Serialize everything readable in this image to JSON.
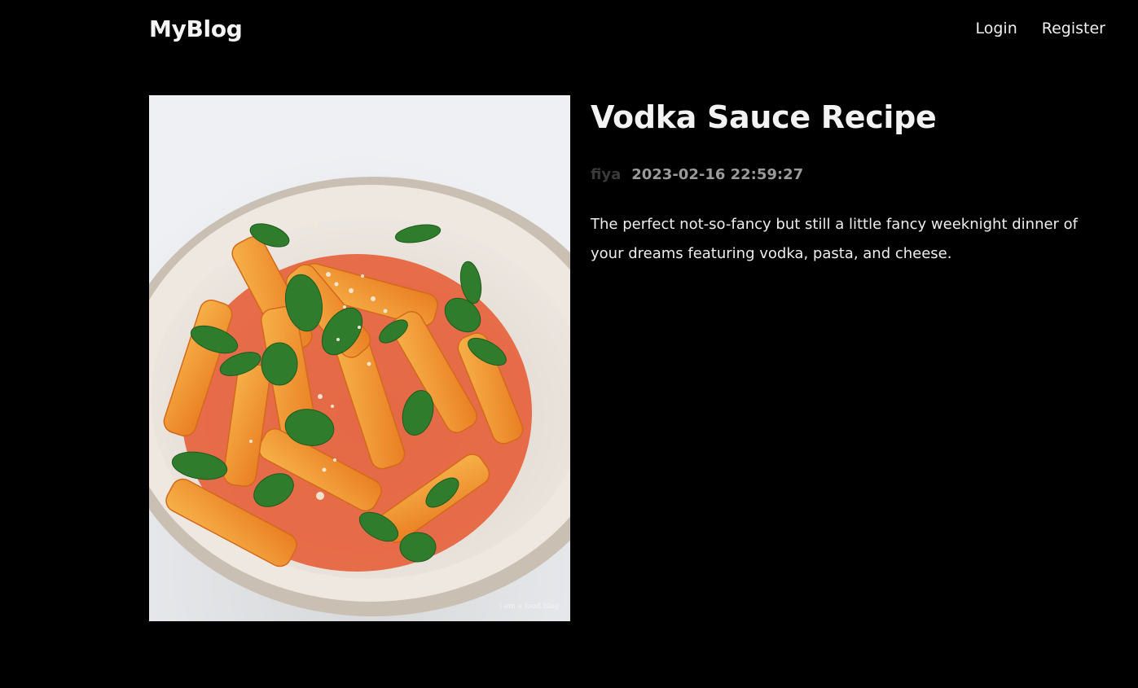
{
  "header": {
    "brand": "MyBlog",
    "nav": [
      {
        "label": "Login"
      },
      {
        "label": "Register"
      }
    ]
  },
  "post": {
    "title": "Vodka Sauce Recipe",
    "author": "fiya",
    "date": "2023-02-16 22:59:27",
    "body": "The perfect not-so-fancy but still a little fancy weeknight dinner of your dreams featuring vodka, pasta, and cheese.",
    "image_credit": "i am a food blog"
  },
  "colors": {
    "background": "#000000",
    "text": "#f2f2f2",
    "author": "#3a3a3a",
    "date": "#9a9a9a"
  }
}
